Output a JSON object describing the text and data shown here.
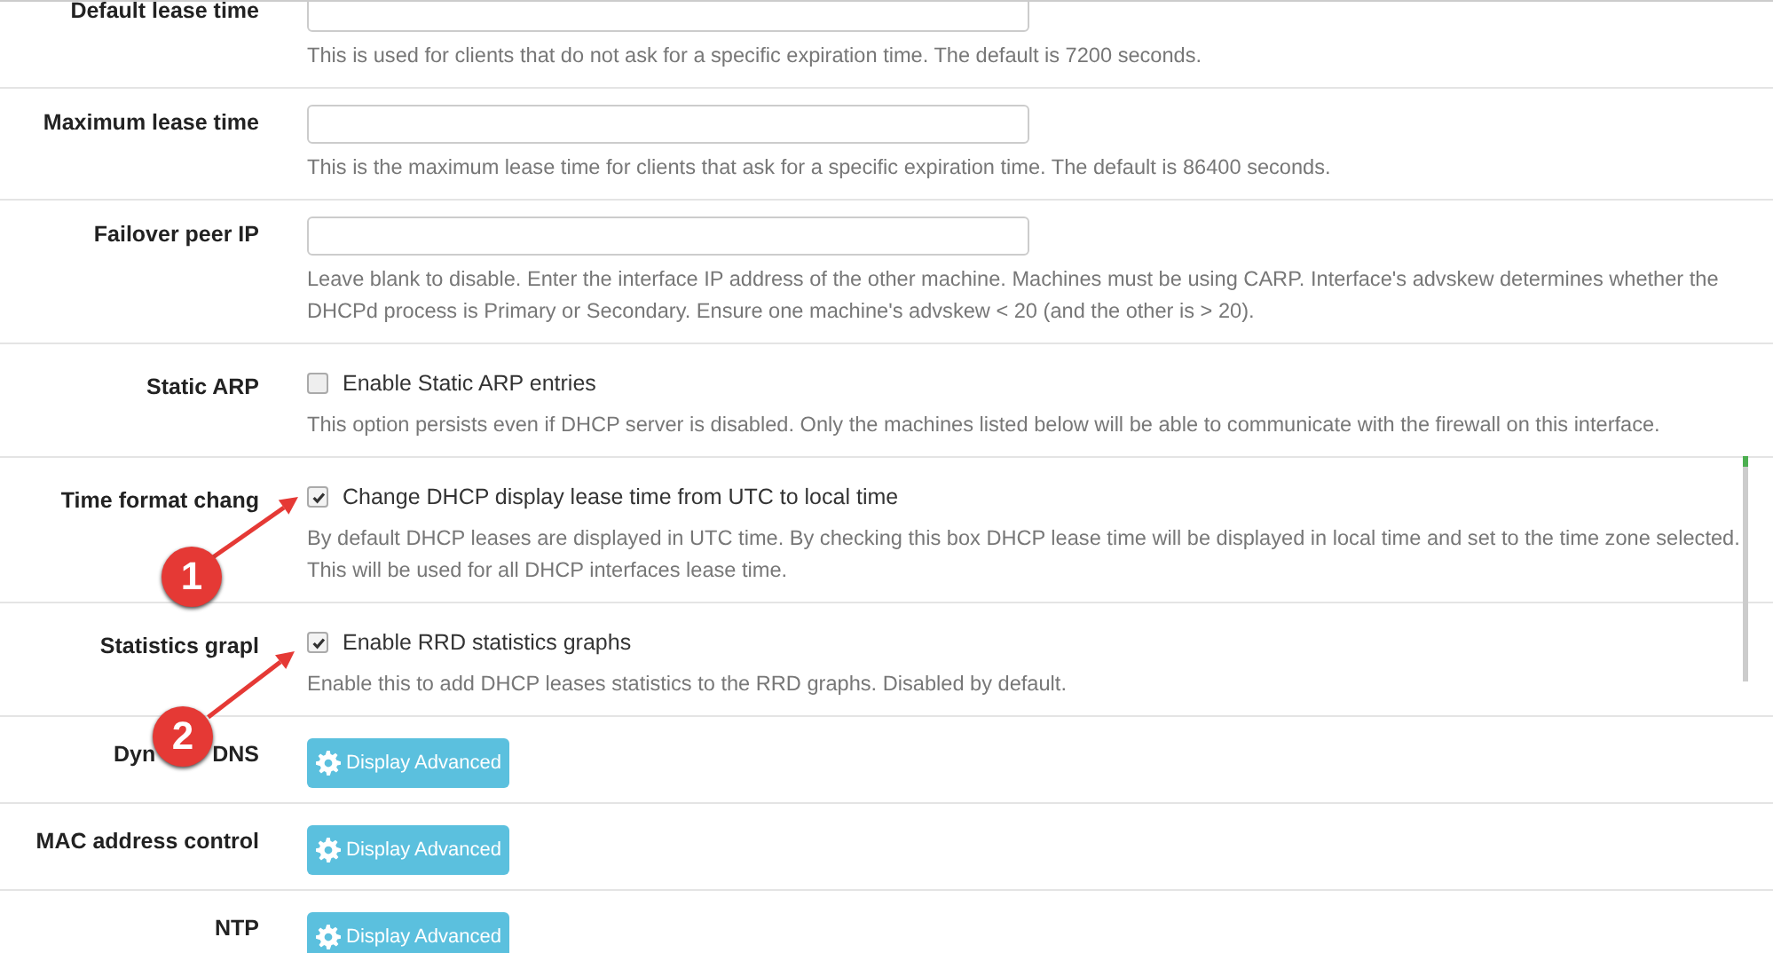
{
  "rows": [
    {
      "kind": "input",
      "label": "Default lease time",
      "help": "This is used for clients that do not ask for a specific expiration time. The default is 7200 seconds."
    },
    {
      "kind": "input",
      "label": "Maximum lease time",
      "help": "This is the maximum lease time for clients that ask for a specific expiration time. The default is 86400 seconds."
    },
    {
      "kind": "input",
      "label": "Failover peer IP",
      "help": "Leave blank to disable. Enter the interface IP address of the other machine. Machines must be using CARP. Interface's advskew determines whether the DHCPd process is Primary or Secondary. Ensure one machine's advskew < 20 (and the other is > 20)."
    },
    {
      "kind": "checkbox",
      "label": "Static ARP",
      "checked": false,
      "option": "Enable Static ARP entries",
      "help": "This option persists even if DHCP server is disabled. Only the machines listed below will be able to communicate with the firewall on this interface."
    },
    {
      "kind": "checkbox",
      "label": "Time format chang",
      "checked": true,
      "option": "Change DHCP display lease time from UTC to local time",
      "help": "By default DHCP leases are displayed in UTC time. By checking this box DHCP lease time will be displayed in local time and set to the time zone selected. This will be used for all DHCP interfaces lease time.",
      "callout": "1"
    },
    {
      "kind": "checkbox",
      "label": "Statistics grapl",
      "checked": true,
      "option": "Enable RRD statistics graphs",
      "help": "Enable this to add DHCP leases statistics to the RRD graphs. Disabled by default.",
      "callout": "2"
    },
    {
      "kind": "button",
      "label_parts": [
        "Dyn",
        "DNS"
      ],
      "button": "Display Advanced"
    },
    {
      "kind": "button",
      "label": "MAC address control",
      "button": "Display Advanced"
    },
    {
      "kind": "button",
      "label": "NTP",
      "button": "Display Advanced"
    }
  ]
}
